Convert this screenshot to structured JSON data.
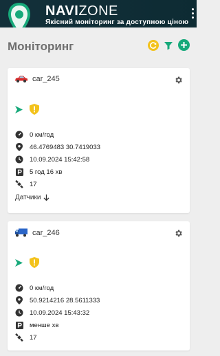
{
  "brand": {
    "name_bold": "NAVI",
    "name_light": "ZONE",
    "tagline": "Якісний моніторинг за доступною ціною"
  },
  "page": {
    "title": "Моніторинг"
  },
  "colors": {
    "accent_green": "#16a97a",
    "warning_yellow": "#f3c21b",
    "header_bg": "#13303a"
  },
  "actions": [
    {
      "icon": "refresh-icon",
      "color": "#f3c21b"
    },
    {
      "icon": "filter-icon",
      "color": "#16a97a"
    },
    {
      "icon": "add-icon",
      "color": "#16a97a"
    }
  ],
  "vehicles": [
    {
      "name": "car_245",
      "vehicle_icon": "red-car-icon",
      "speed": "0 км/год",
      "coordinates": "46.4769483 30.7419033",
      "datetime": "10.09.2024 15:42:58",
      "parking": "5 год 16 хв",
      "satellites": "17",
      "sensors_label": "Датчики"
    },
    {
      "name": "car_246",
      "vehicle_icon": "blue-truck-icon",
      "speed": "0 км/год",
      "coordinates": "50.9214216 28.5611333",
      "datetime": "10.09.2024 15:43:32",
      "parking": "менше хв",
      "satellites": "17"
    }
  ]
}
